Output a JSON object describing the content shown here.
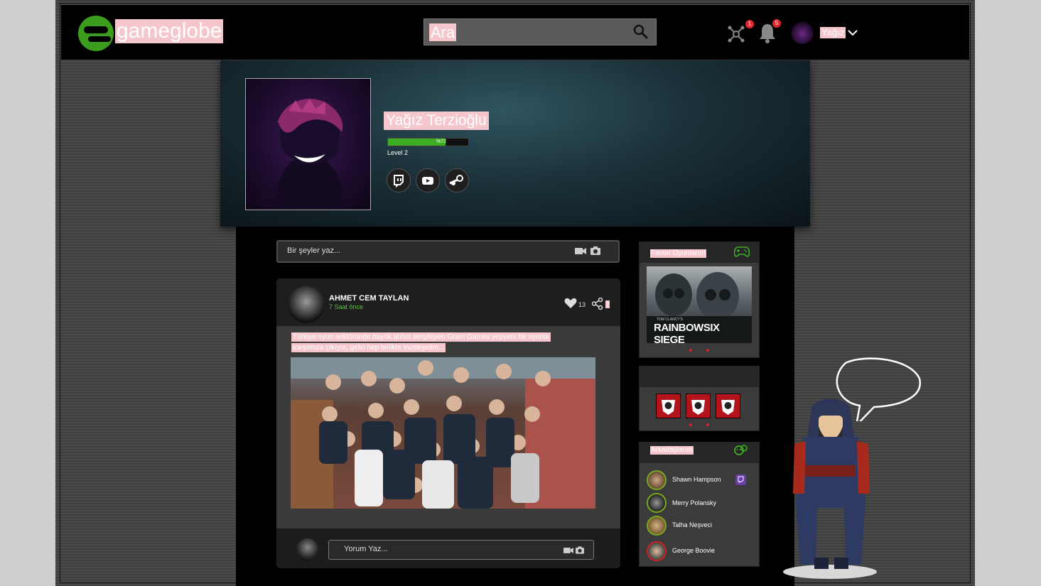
{
  "brand": {
    "name": "gameglobe",
    "accent": "#3a9e1c"
  },
  "search": {
    "placeholder": "Ara"
  },
  "header": {
    "network_badge": "1",
    "notifications_badge": "5",
    "username": "Yağız"
  },
  "profile": {
    "name": "Yağız Terzioğlu",
    "xp_text": "%72",
    "xp_percent": 72,
    "level": "Level 2",
    "social": [
      "twitch-icon",
      "youtube-icon",
      "steam-icon"
    ]
  },
  "composer": {
    "placeholder": "Bir şeyler yaz..."
  },
  "post": {
    "author": "AHMET CEM TAYLAN",
    "time": "7 Saat önce",
    "likes": "13",
    "shares": "2",
    "text_line1": "Türkiye oyun sektöründe büyük atılım sergileyen Gram Games yepyeni bir oyunla",
    "text_line2": "karşımıza çıkıyor, gelin hep birlikte inceleyelim..."
  },
  "comment": {
    "placeholder": "Yorum Yaz..."
  },
  "favorites": {
    "title": "Favori Oyunlarım",
    "game_line1": "TOM CLANCY'S",
    "game_line2": "RAINBOWSIX SIEGE"
  },
  "friends": {
    "title": "Arkadaşlarım",
    "list": [
      "Shawn Hampson",
      "Merry Polansky",
      "Talha Neşveci",
      "George Boovie"
    ]
  }
}
